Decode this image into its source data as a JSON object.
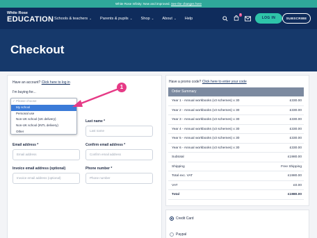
{
  "announcement": {
    "text": "White Rose Infinity: New and improved. ",
    "link": "See the changes here"
  },
  "logo": {
    "top": "White Rose",
    "bottom": "EDUCATION"
  },
  "nav": [
    {
      "label": "Schools & teachers",
      "chevron": "⌄"
    },
    {
      "label": "Parents & pupils",
      "chevron": "⌄"
    },
    {
      "label": "Shop",
      "chevron": "⌄"
    },
    {
      "label": "About",
      "chevron": "⌄"
    },
    {
      "label": "Help",
      "chevron": ""
    }
  ],
  "icons": {
    "search": "search-icon",
    "bag": "bag-icon",
    "mail": "mail-icon",
    "bag_count": "0"
  },
  "buttons": {
    "login": "LOG IN",
    "subscribe": "SUBSCRIBE"
  },
  "hero": {
    "title": "Checkout"
  },
  "account": {
    "prompt": "Have an account? ",
    "link": "Click here to log in"
  },
  "buying_for": {
    "label": "I'm buying for...",
    "options": [
      "Please choose",
      "My school",
      "Personal use",
      "Non-UK school (UK delivery)",
      "Non-UK school (INTL delivery)",
      "Other"
    ],
    "selected_index": 1
  },
  "form": {
    "last_name_label": "Last name *",
    "last_name_placeholder": "Last name",
    "email_label": "Email address *",
    "email_placeholder": "Email address",
    "confirm_email_label": "Confirm email address *",
    "confirm_email_placeholder": "Confirm email address",
    "invoice_email_label": "Invoice email address (optional)",
    "invoice_email_placeholder": "Invoice email address (optional)",
    "phone_label": "Phone number *",
    "phone_placeholder": "Phone number"
  },
  "promo": {
    "prompt": "Have a promo code? ",
    "link": "Click here to enter your code"
  },
  "summary": {
    "heading": "Order Summary",
    "rows": [
      {
        "item": "Year 1 - Annual workbooks (v3 schemes) x 30",
        "price": "£330.00",
        "bold": false
      },
      {
        "item": "Year 2 - Annual workbooks (v3 schemes) x 30",
        "price": "£330.00",
        "bold": false
      },
      {
        "item": "Year 3 - Annual workbooks (v3 schemes) x 30",
        "price": "£330.00",
        "bold": false
      },
      {
        "item": "Year 4 - Annual workbooks (v3 schemes) x 30",
        "price": "£330.00",
        "bold": false
      },
      {
        "item": "Year 5 - Annual workbooks (v3 schemes) x 30",
        "price": "£330.00",
        "bold": false
      },
      {
        "item": "Year 6 - Annual workbooks (v3 schemes) x 30",
        "price": "£330.00",
        "bold": false
      },
      {
        "item": "Subtotal",
        "price": "£1980.00",
        "bold": false
      },
      {
        "item": "Shipping",
        "price": "Free Shipping",
        "bold": false
      },
      {
        "item": "Total exc. VAT",
        "price": "£1980.00",
        "bold": false
      },
      {
        "item": "VAT",
        "price": "£0.00",
        "bold": false
      },
      {
        "item": "Total",
        "price": "£1980.00",
        "bold": true
      }
    ]
  },
  "payment": {
    "options": [
      {
        "label": "Credit Card",
        "selected": true
      },
      {
        "label": "Paypal",
        "selected": false
      }
    ]
  },
  "callout": {
    "number": "1",
    "color": "#e63a86"
  },
  "colors": {
    "nav": "#0f2c5c",
    "accent": "#2ec4a9",
    "banner": "#2fa89a",
    "selected": "#3b7bd8"
  }
}
